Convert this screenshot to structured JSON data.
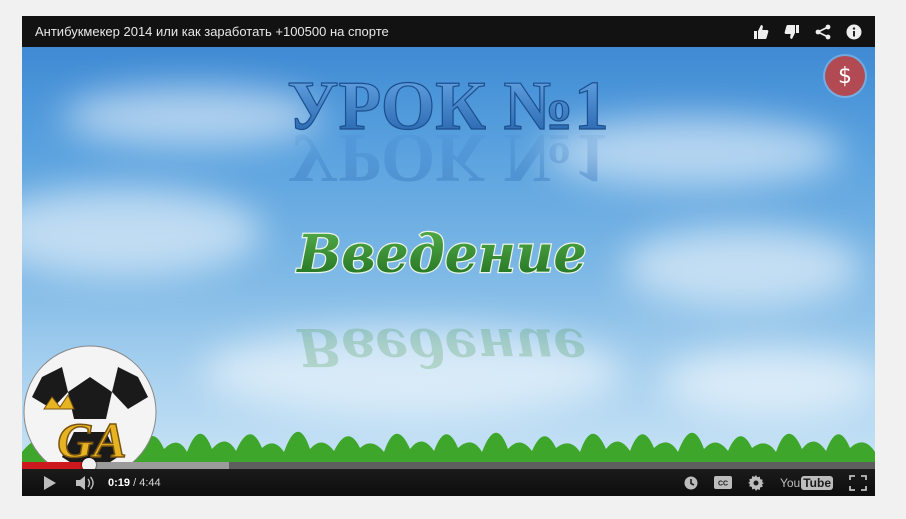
{
  "video": {
    "title": "Антибукмекер 2014 или как заработать +100500  на спорте",
    "heading": "УРОК №1",
    "subheading": "Введение",
    "watermark": "GA",
    "money_button": "$"
  },
  "title_icons": [
    "thumbs-up-icon",
    "thumbs-down-icon",
    "share-icon",
    "info-icon"
  ],
  "player": {
    "current_time": "0:19",
    "separator": " / ",
    "duration": "4:44",
    "progress_played": 0.078,
    "progress_buffered": 0.243,
    "youtube_label_a": "You",
    "youtube_label_b": "Tube"
  },
  "colors": {
    "progress_red": "#cc181e",
    "heading_blue": "#2e6db8",
    "subheading_green": "#2f8a2c",
    "money_button": "#b14a52"
  }
}
